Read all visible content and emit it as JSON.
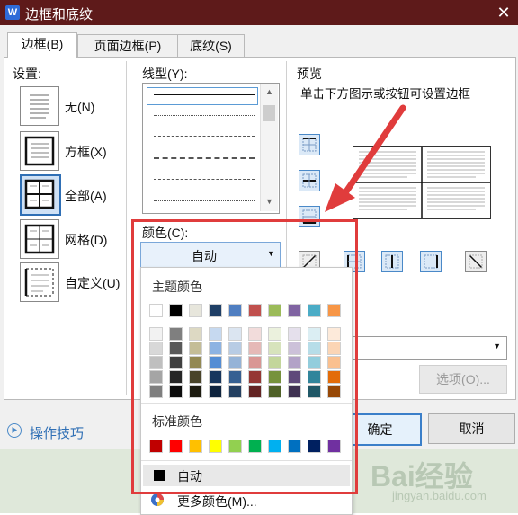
{
  "window": {
    "title": "边框和底纹",
    "close_label": "✕"
  },
  "tabs": [
    "边框(B)",
    "页面边框(P)",
    "底纹(S)"
  ],
  "settings": {
    "heading": "设置:",
    "items": [
      "无(N)",
      "方框(X)",
      "全部(A)",
      "网格(D)",
      "自定义(U)"
    ]
  },
  "line_style": {
    "label": "线型(Y):"
  },
  "color": {
    "label": "颜色(C):",
    "value": "自动"
  },
  "preview": {
    "heading": "预览",
    "hint": "单击下方图示或按钮可设置边框"
  },
  "dropdown": {
    "theme_heading": "主题颜色",
    "standard_heading": "标准颜色",
    "auto_label": "自动",
    "more_label": "更多颜色(M)...",
    "theme_top": [
      "#ffffff",
      "#000000",
      "#e7e6dc",
      "#1f3f66",
      "#4f7ec1",
      "#c0504d",
      "#9bbb59",
      "#8064a2",
      "#4bacc6",
      "#f79646"
    ],
    "theme_shades": [
      [
        "#f2f2f2",
        "#7f7f7f",
        "#ddd9c3",
        "#c6d9f0",
        "#dbe5f1",
        "#f2dcdb",
        "#ebf1dd",
        "#e5e0ec",
        "#dbeef3",
        "#fdeada"
      ],
      [
        "#d8d8d8",
        "#595959",
        "#c4bd97",
        "#8db3e2",
        "#b8cce4",
        "#e5b9b7",
        "#d7e3bc",
        "#ccc1d9",
        "#b7dde8",
        "#fbd5b5"
      ],
      [
        "#bfbfbf",
        "#3f3f3f",
        "#938953",
        "#548dd4",
        "#95b3d7",
        "#d99694",
        "#c3d69b",
        "#b2a2c7",
        "#92cddc",
        "#fac08f"
      ],
      [
        "#a5a5a5",
        "#262626",
        "#494429",
        "#17365d",
        "#366092",
        "#953734",
        "#76923c",
        "#5f497a",
        "#31859b",
        "#e36c09"
      ],
      [
        "#7f7f7f",
        "#0c0c0c",
        "#1d1b10",
        "#0f243e",
        "#244061",
        "#632423",
        "#4f6128",
        "#3f3151",
        "#205867",
        "#974806"
      ]
    ],
    "standard": [
      "#c00000",
      "#ff0000",
      "#ffc000",
      "#ffff00",
      "#92d050",
      "#00b050",
      "#00b0f0",
      "#0070c0",
      "#002060",
      "#7030a0"
    ]
  },
  "buttons": {
    "options": "选项(O)...",
    "ok": "确定",
    "cancel": "取消"
  },
  "tips": {
    "label": "操作技巧"
  },
  "width_label": ":",
  "watermark": {
    "brand": "Bai经验",
    "url": "jingyan.baidu.com"
  },
  "colors": {
    "title_bar": "#5e1a1a",
    "annotation": "#e03c3c",
    "accent": "#4a89c8"
  }
}
